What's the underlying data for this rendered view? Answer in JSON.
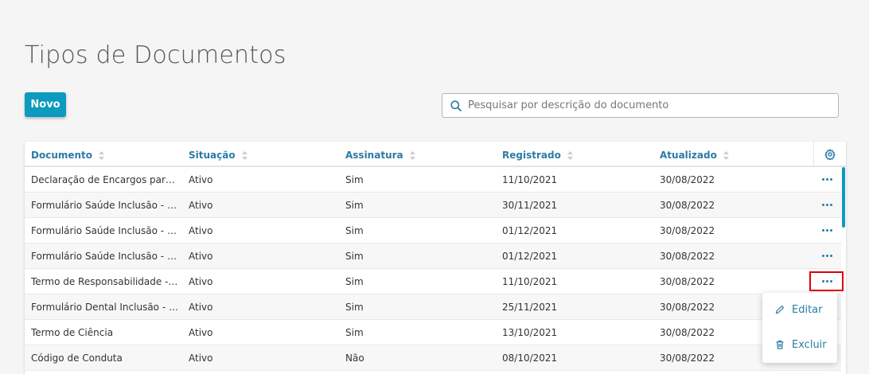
{
  "page": {
    "title": "Tipos de Documentos"
  },
  "toolbar": {
    "new_label": "Novo"
  },
  "search": {
    "placeholder": "Pesquisar por descrição do documento",
    "value": ""
  },
  "table": {
    "columns": [
      "Documento",
      "Situação",
      "Assinatura",
      "Registrado",
      "Atualizado"
    ],
    "rows": [
      [
        "Declaração de Encargos para Fins de IR",
        "Ativo",
        "Sim",
        "11/10/2021",
        "30/08/2022"
      ],
      [
        "Formulário Saúde Inclusão - Hapvida",
        "Ativo",
        "Sim",
        "30/11/2021",
        "30/08/2022"
      ],
      [
        "Formulário Saúde Inclusão - ASL",
        "Ativo",
        "Sim",
        "01/12/2021",
        "30/08/2022"
      ],
      [
        "Formulário Saúde Inclusão - ASL",
        "Ativo",
        "Sim",
        "01/12/2021",
        "30/08/2022"
      ],
      [
        "Termo de Responsabilidade - Celular",
        "Ativo",
        "Sim",
        "11/10/2021",
        "30/08/2022"
      ],
      [
        "Formulário Dental Inclusão - Hapvida",
        "Ativo",
        "Sim",
        "25/11/2021",
        "30/08/2022"
      ],
      [
        "Termo de Ciência",
        "Ativo",
        "Sim",
        "13/10/2021",
        "30/08/2022"
      ],
      [
        "Código de Conduta",
        "Ativo",
        "Não",
        "08/10/2021",
        "30/08/2022"
      ]
    ]
  },
  "dropdown": {
    "edit_label": "Editar",
    "delete_label": "Excluir"
  },
  "colors": {
    "accent": "#0c9abe",
    "link": "#2b7ba6",
    "highlight": "#e00000"
  }
}
